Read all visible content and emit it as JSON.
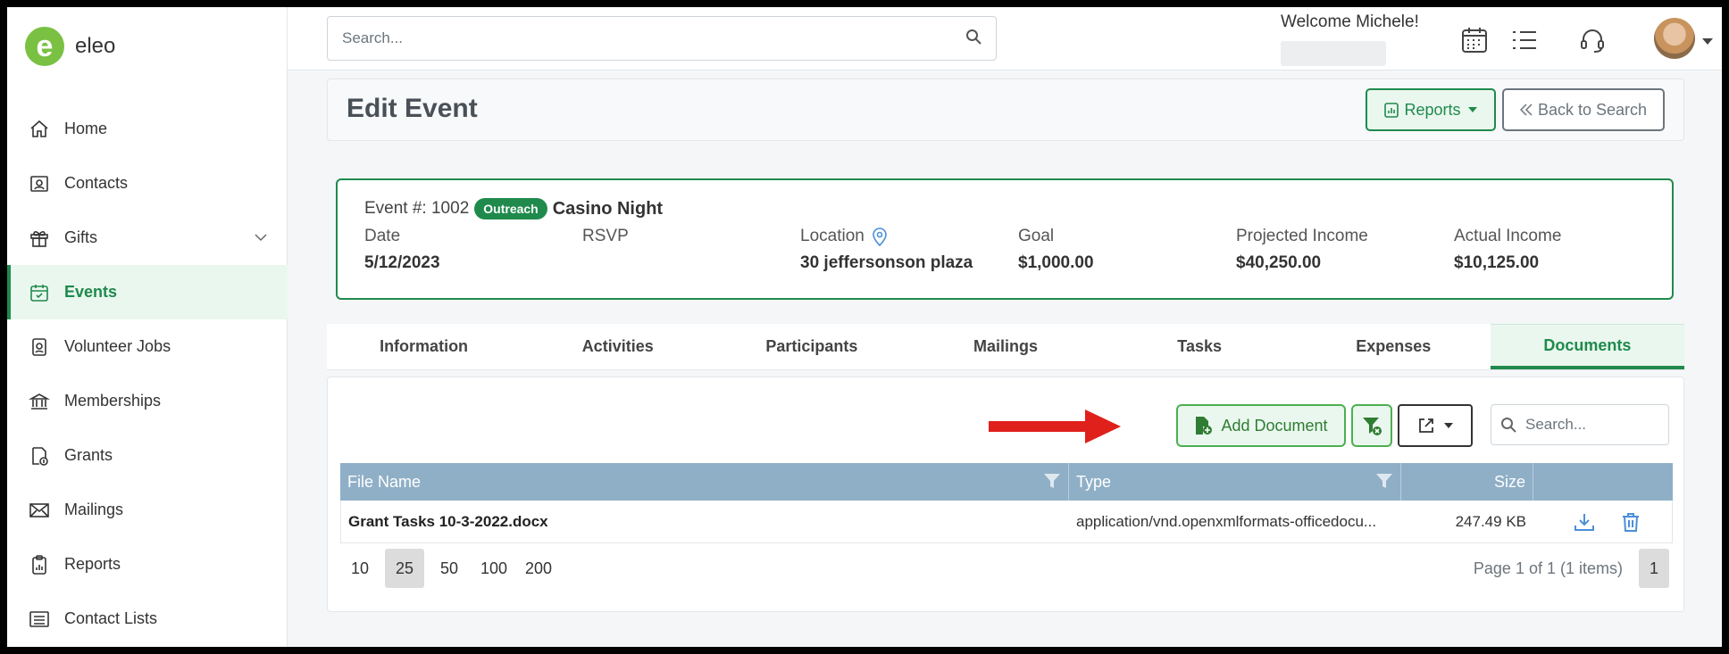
{
  "app": {
    "logo_text": "eleo",
    "logo_mark": "e"
  },
  "sidebar": {
    "items": [
      {
        "label": "Home",
        "icon": "home-icon"
      },
      {
        "label": "Contacts",
        "icon": "contacts-icon"
      },
      {
        "label": "Gifts",
        "icon": "gift-icon"
      },
      {
        "label": "Events",
        "icon": "calendar-check-icon"
      },
      {
        "label": "Volunteer Jobs",
        "icon": "badge-icon"
      },
      {
        "label": "Memberships",
        "icon": "bank-icon"
      },
      {
        "label": "Grants",
        "icon": "grant-icon"
      },
      {
        "label": "Mailings",
        "icon": "envelope-icon"
      },
      {
        "label": "Reports",
        "icon": "clipboard-icon"
      },
      {
        "label": "Contact Lists",
        "icon": "list-icon"
      }
    ]
  },
  "topbar": {
    "search_placeholder": "Search...",
    "welcome": "Welcome Michele!"
  },
  "header": {
    "title": "Edit Event",
    "reports_label": "Reports",
    "back_label": "Back to Search"
  },
  "event": {
    "number_label": "Event #: 1002",
    "badge": "Outreach",
    "name": "Casino Night",
    "date_label": "Date",
    "date_value": "5/12/2023",
    "rsvp_label": "RSVP",
    "rsvp_value": "",
    "location_label": "Location",
    "location_value": "30 jeffersonson plaza",
    "goal_label": "Goal",
    "goal_value": "$1,000.00",
    "projected_label": "Projected Income",
    "projected_value": "$40,250.00",
    "actual_label": "Actual Income",
    "actual_value": "$10,125.00"
  },
  "tabs": [
    "Information",
    "Activities",
    "Participants",
    "Mailings",
    "Tasks",
    "Expenses",
    "Documents"
  ],
  "documents": {
    "add_label": "Add Document",
    "search_placeholder": "Search...",
    "columns": {
      "file_name": "File Name",
      "type": "Type",
      "size": "Size"
    },
    "rows": [
      {
        "file_name": "Grant Tasks 10-3-2022.docx",
        "type": "application/vnd.openxmlformats-officedocu...",
        "size": "247.49 KB"
      }
    ],
    "page_sizes": [
      "10",
      "25",
      "50",
      "100",
      "200"
    ],
    "selected_page_size": "25",
    "page_info": "Page 1 of 1 (1 items)",
    "current_page": "1"
  },
  "colors": {
    "brand_green": "#1f8a4c",
    "logo_green": "#7ac143",
    "grid_header": "#8fafc7",
    "arrow_red": "#e0201b"
  }
}
